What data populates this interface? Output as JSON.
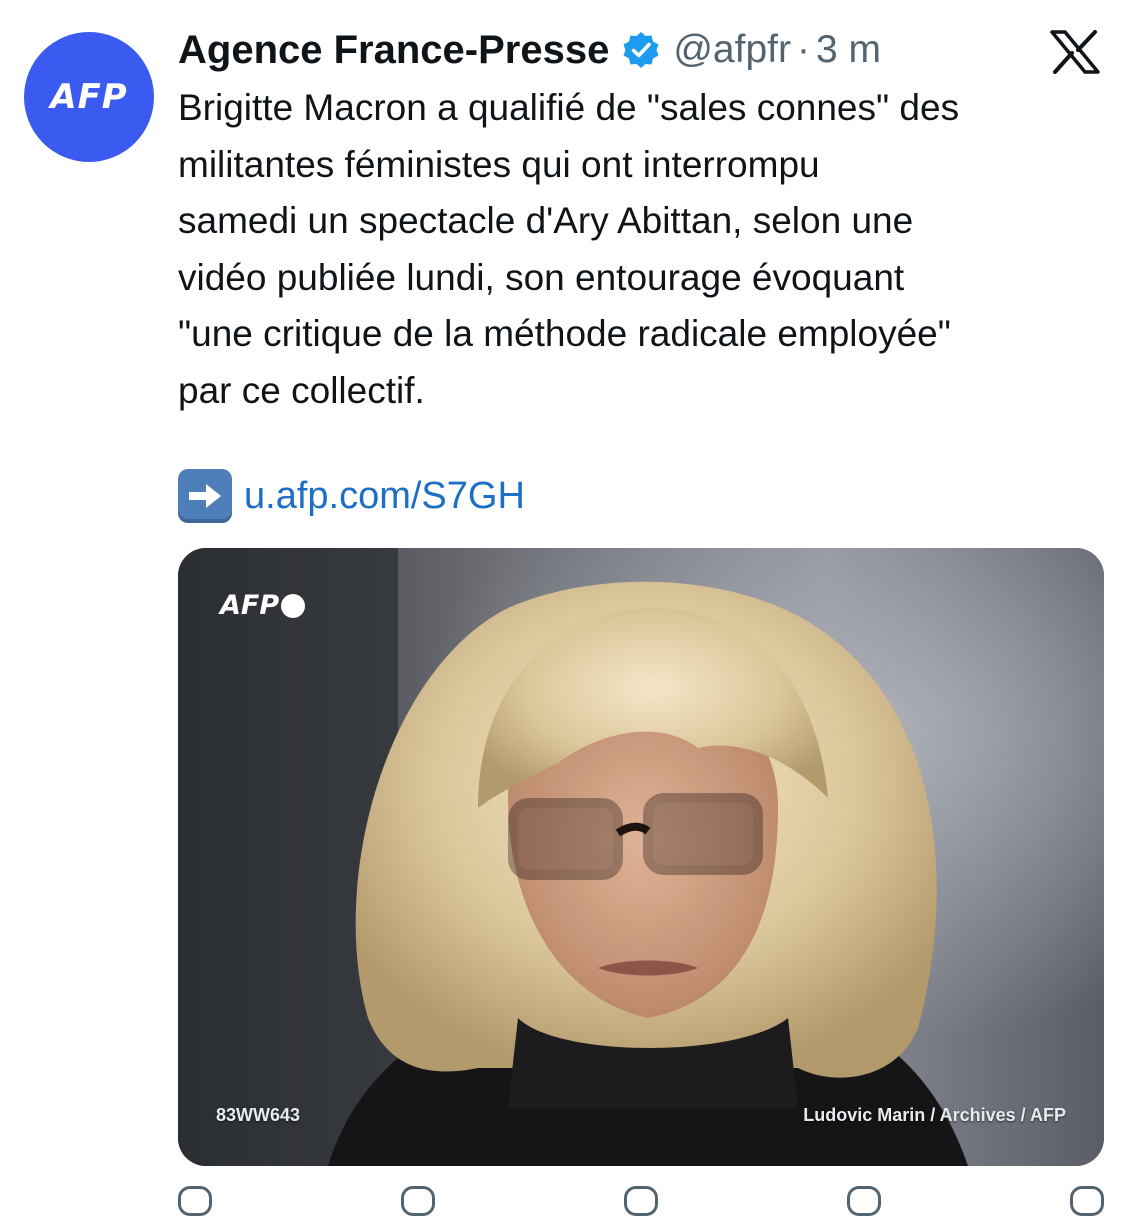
{
  "tweet": {
    "avatar_text": "AFP",
    "display_name": "Agence France-Presse",
    "verified_icon": "verified-badge-icon",
    "handle": "@afpfr",
    "separator": "·",
    "time": "3 m",
    "platform_icon": "x-logo-icon",
    "text": "Brigitte Macron a qualifié de \"sales connes\" des\nmilitantes féministes qui ont interrompu\nsamedi un spectacle d'Ary Abittan, selon une\nvidéo publiée lundi, son entourage évoquant\n\"une critique de la méthode radicale employée\"\npar ce collectif.",
    "link_icon": "right-arrow-emoji-icon",
    "link": "u.afp.com/S7GH",
    "media": {
      "watermark": "AFP",
      "photo_id": "83WW643",
      "credit": "Ludovic Marin / Archives / AFP"
    },
    "actions": [
      "reply-icon",
      "retweet-icon",
      "like-icon",
      "views-icon",
      "bookmark-icon",
      "share-icon"
    ]
  },
  "colors": {
    "avatar_bg": "#3b5bf0",
    "verified": "#1d9bf0",
    "link": "#1d6fc3",
    "secondary_text": "#536471"
  }
}
